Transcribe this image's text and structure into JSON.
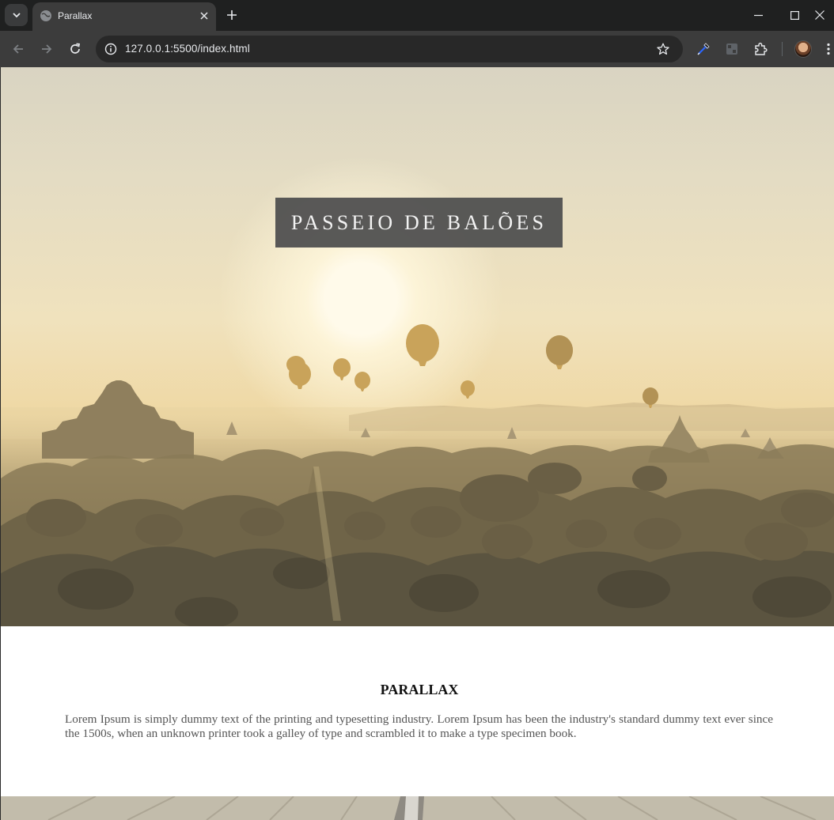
{
  "browser": {
    "tab_title": "Parallax",
    "url_host": "127.0.0.1",
    "url_path": ":5500/index.html"
  },
  "icons": {
    "tab_list": "chevron-down-icon",
    "favicon": "globe-icon",
    "tab_close": "close-icon",
    "new_tab": "plus-icon",
    "minimize": "minimize-icon",
    "maximize": "maximize-icon",
    "close_window": "close-icon",
    "back": "arrow-left-icon",
    "forward": "arrow-right-icon",
    "reload": "reload-icon",
    "site_info": "info-icon",
    "bookmark": "star-icon",
    "eyedropper": "eyedropper-icon",
    "extension_app": "extension-icon",
    "extensions": "puzzle-icon",
    "profile": "avatar",
    "menu": "kebab-menu-icon"
  },
  "hero": {
    "title": "PASSEIO DE BALÕES"
  },
  "section": {
    "title": "PARALLAX",
    "text": "Lorem Ipsum is simply dummy text of the printing and typesetting industry. Lorem Ipsum has been the industry's standard dummy text ever since the 1500s, when an unknown printer took a galley of type and scrambled it to make a type specimen book."
  },
  "colors": {
    "chrome_dark": "#1f2020",
    "toolbar": "#3c3c3c",
    "title_box": "#505050"
  }
}
